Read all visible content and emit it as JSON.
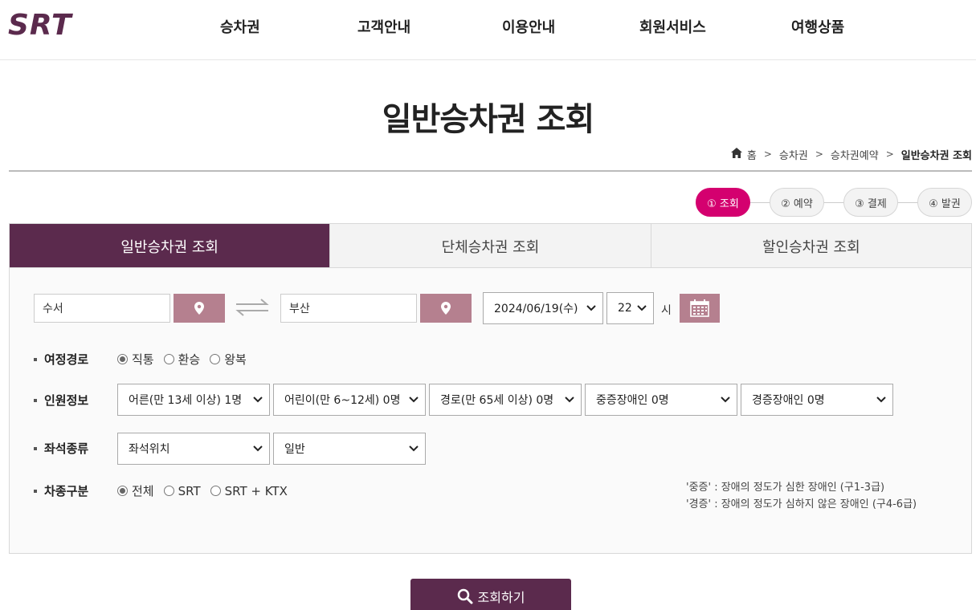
{
  "header": {
    "logo_text": "SRT",
    "nav": [
      "승차권",
      "고객안내",
      "이용안내",
      "회원서비스",
      "여행상품"
    ]
  },
  "page": {
    "title": "일반승차권 조회",
    "breadcrumb": [
      "홈",
      "승차권",
      "승차권예약",
      "일반승차권 조회"
    ]
  },
  "steps": [
    "① 조회",
    "② 예약",
    "③ 결제",
    "④ 발권"
  ],
  "tabs": [
    "일반승차권 조회",
    "단체승차권 조회",
    "할인승차권 조회"
  ],
  "search": {
    "departure": "수서",
    "arrival": "부산",
    "date": "2024/06/19(수)",
    "hour": "22",
    "hour_unit": "시"
  },
  "route": {
    "label": "여정경로",
    "options": [
      "직통",
      "환승",
      "왕복"
    ],
    "selected": "직통"
  },
  "passengers": {
    "label": "인원정보",
    "selects": [
      "어른(만 13세 이상) 1명",
      "어린이(만 6~12세) 0명",
      "경로(만 65세 이상) 0명",
      "중증장애인 0명",
      "경증장애인 0명"
    ]
  },
  "seat": {
    "label": "좌석종류",
    "selects": [
      "좌석위치",
      "일반"
    ]
  },
  "train_type": {
    "label": "차종구분",
    "options": [
      "전체",
      "SRT",
      "SRT + KTX"
    ],
    "selected": "전체"
  },
  "notes": [
    "'중증' : 장애의 정도가 심한 장애인 (구1-3급)",
    "'경증' : 장애의 정도가 심하지 않은 장애인 (구4-6급)"
  ],
  "search_button": "조회하기",
  "colors": {
    "primary": "#5b2a4d",
    "accent": "#d4006f",
    "pin_button": "#b5808f"
  }
}
